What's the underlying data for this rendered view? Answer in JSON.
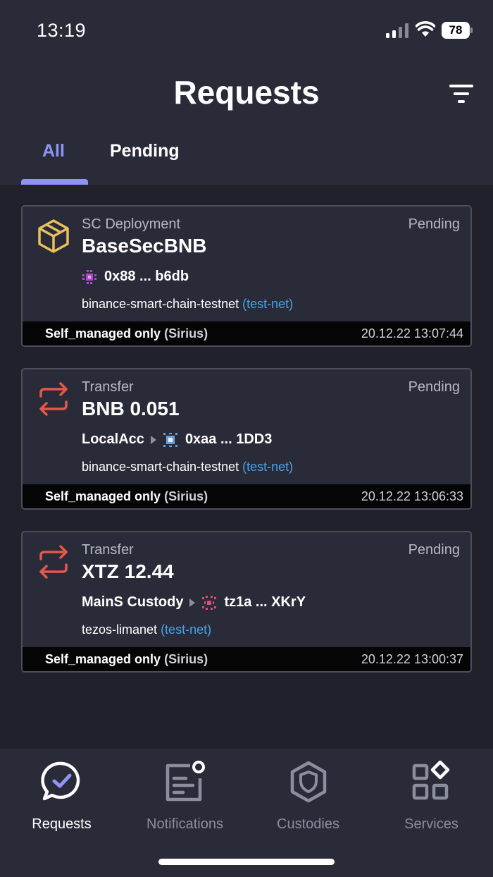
{
  "status_bar": {
    "time": "13:19",
    "battery": "78"
  },
  "header": {
    "title": "Requests"
  },
  "tabs": [
    {
      "label": "All",
      "active": true
    },
    {
      "label": "Pending",
      "active": false
    }
  ],
  "requests": [
    {
      "type": "SC Deployment",
      "status": "Pending",
      "title": "BaseSecBNB",
      "from": "",
      "address": "0x88 ... b6db",
      "network": "binance-smart-chain-testnet",
      "network_tag": "(test-net)",
      "policy": "Self_managed only",
      "policy_owner": "(Sirius)",
      "timestamp": "20.12.22 13:07:44",
      "icon": "box-icon"
    },
    {
      "type": "Transfer",
      "status": "Pending",
      "title": "BNB 0.051",
      "from": "LocalAcc",
      "address": "0xaa ... 1DD3",
      "network": "binance-smart-chain-testnet",
      "network_tag": "(test-net)",
      "policy": "Self_managed only",
      "policy_owner": "(Sirius)",
      "timestamp": "20.12.22 13:06:33",
      "icon": "transfer-icon"
    },
    {
      "type": "Transfer",
      "status": "Pending",
      "title": "XTZ 12.44",
      "from": "MainS Custody",
      "address": "tz1a ... XKrY",
      "network": "tezos-limanet",
      "network_tag": "(test-net)",
      "policy": "Self_managed only",
      "policy_owner": "(Sirius)",
      "timestamp": "20.12.22 13:00:37",
      "icon": "transfer-icon"
    }
  ],
  "bottom_nav": [
    {
      "label": "Requests",
      "icon": "chat-check-icon",
      "active": true
    },
    {
      "label": "Notifications",
      "icon": "notification-list-icon",
      "active": false
    },
    {
      "label": "Custodies",
      "icon": "shield-hexagon-icon",
      "active": false
    },
    {
      "label": "Services",
      "icon": "grid-diamond-icon",
      "active": false
    }
  ],
  "colors": {
    "background": "#20212b",
    "surface": "#2a2b38",
    "accent": "#8f93f5",
    "transfer_icon": "#e4574a",
    "deploy_icon": "#e8c15a",
    "link": "#4aa3e6"
  }
}
